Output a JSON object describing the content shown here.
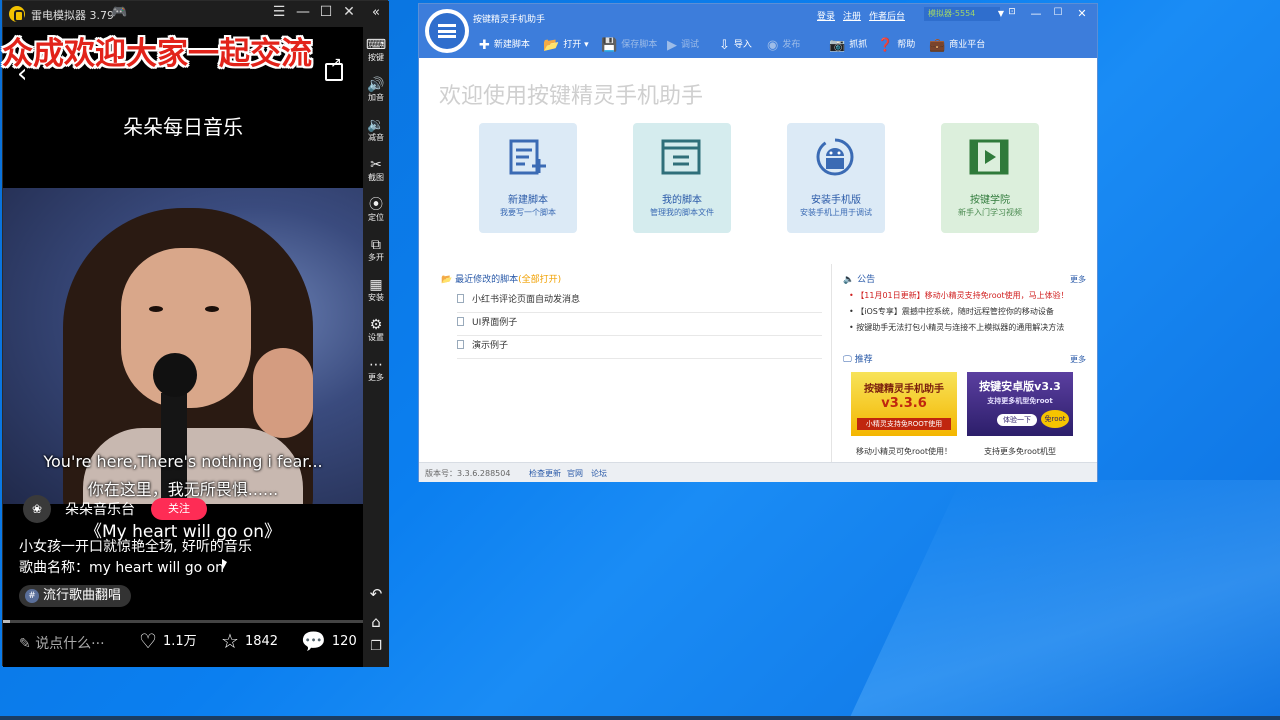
{
  "overlay": {
    "text": "众成欢迎大家一起交流"
  },
  "emulator": {
    "title": "雷电模拟器 3.79",
    "controls": {
      "menu": "☰",
      "minimize": "—",
      "maximize": "☐",
      "close": "✕",
      "collapse": "«"
    },
    "sidebar": [
      {
        "name": "keyboard",
        "label": "按键",
        "icon": "⌨"
      },
      {
        "name": "volume-up",
        "label": "加音",
        "icon": "🔊"
      },
      {
        "name": "volume-down",
        "label": "减音",
        "icon": "🔉"
      },
      {
        "name": "screenshot",
        "label": "截图",
        "icon": "✂"
      },
      {
        "name": "location",
        "label": "定位",
        "icon": "⦿"
      },
      {
        "name": "multi-open",
        "label": "多开",
        "icon": "⧉"
      },
      {
        "name": "install",
        "label": "安装",
        "icon": "▦"
      },
      {
        "name": "settings",
        "label": "设置",
        "icon": "⚙"
      },
      {
        "name": "more",
        "label": "更多",
        "icon": "⋯"
      }
    ],
    "nav": {
      "back": "↶",
      "home": "⌂",
      "recent": "❐"
    }
  },
  "phone": {
    "title": "朵朵每日音乐",
    "subtitle_en": "You're here,There's nothing i fear...",
    "subtitle_cn": "你在这里，我无所畏惧......",
    "author": "朵朵音乐台",
    "follow": "关注",
    "song_title": "《My heart will go on》",
    "desc1": "小女孩一开口就惊艳全场, 好听的音乐",
    "desc2": "歌曲名称：my heart will go on",
    "tag": "流行歌曲翻唱",
    "tag_icon": "#",
    "progress": 0.02,
    "comment_placeholder": "说点什么···",
    "likes": "1.1万",
    "favorites": "1842",
    "comments": "120"
  },
  "app": {
    "title": "按键精灵手机助手",
    "links": {
      "login": "登录",
      "register": "注册",
      "author_backend": "作者后台"
    },
    "device": "模拟器-5554",
    "toolbar": {
      "new_script": "新建脚本",
      "open": "打开",
      "save_script": "保存脚本",
      "debug": "调试",
      "import": "导入",
      "publish": "发布",
      "capture": "抓抓",
      "help": "帮助",
      "business": "商业平台"
    },
    "welcome": "欢迎使用按键精灵手机助手",
    "cards": [
      {
        "title": "新建脚本",
        "subtitle": "我要写一个脚本"
      },
      {
        "title": "我的脚本",
        "subtitle": "管理我的脚本文件"
      },
      {
        "title": "安装手机版",
        "subtitle": "安装手机上用于调试"
      },
      {
        "title": "按键学院",
        "subtitle": "新手入门学习视频"
      }
    ],
    "recent": {
      "heading": "最近修改的脚本",
      "open_all": "(全部打开)",
      "items": [
        "小红书评论页面自动发消息",
        "UI界面例子",
        "演示例子"
      ]
    },
    "announcements": {
      "heading": "公告",
      "more": "更多",
      "items": [
        "【11月01日更新】移动小精灵支持免root使用，马上体验！",
        "【iOS专享】震撼中控系统，随时远程管控你的移动设备",
        "按键助手无法打包小精灵与连接不上模拟器的通用解决方法"
      ]
    },
    "recommend": {
      "heading": "推荐",
      "more": "更多",
      "banners": [
        {
          "title": "按键精灵手机助手",
          "version": "v3.3.6",
          "slogan": "小精灵支持免ROOT使用",
          "caption": "移动小精灵可免root使用！"
        },
        {
          "title": "按键安卓版v3.3",
          "slogan": "支持更多机型免root",
          "button": "体验一下",
          "badge": "免root",
          "caption": "支持更多免root机型"
        }
      ]
    },
    "footer": {
      "version_label": "版本号：3.3.6.288504",
      "check_update": "检查更新",
      "website": "官网",
      "forum": "论坛"
    }
  },
  "colors": {
    "app_blue": "#3d7ddb",
    "follow_red": "#fe2c55",
    "overlay_red": "#e2231a"
  }
}
